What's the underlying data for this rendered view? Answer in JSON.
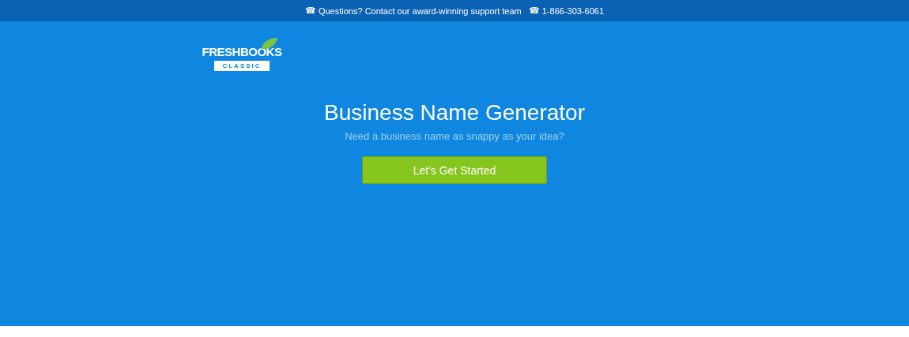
{
  "support_bar": {
    "icon_1": "☎",
    "text": "Questions? Contact our award-winning support team",
    "icon_2": "☎",
    "phone": "1-866-303-6061"
  },
  "logo": {
    "wordmark": "FRESHBOOKS",
    "badge": "CLASSIC"
  },
  "hero": {
    "title": "Business Name Generator",
    "subtitle": "Need a business name as snappy as your idea?",
    "button": "Let's Get Started"
  }
}
